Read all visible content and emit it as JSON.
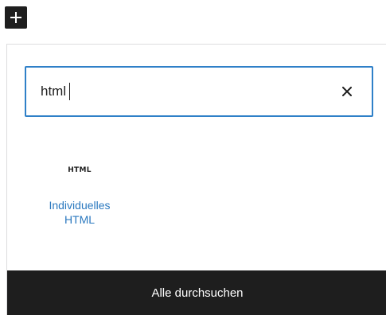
{
  "toolbar": {
    "inserter_icon": "plus-icon"
  },
  "search": {
    "value": "html",
    "placeholder": "",
    "clear_icon": "close-icon"
  },
  "results": [
    {
      "icon_text": "HTML",
      "label": "Individuelles HTML"
    }
  ],
  "footer": {
    "browse_all_label": "Alle durchsuchen"
  },
  "colors": {
    "accent": "#2f80c8",
    "link": "#2a78bf",
    "dark": "#1e1e1e",
    "border": "#dcdcde"
  }
}
